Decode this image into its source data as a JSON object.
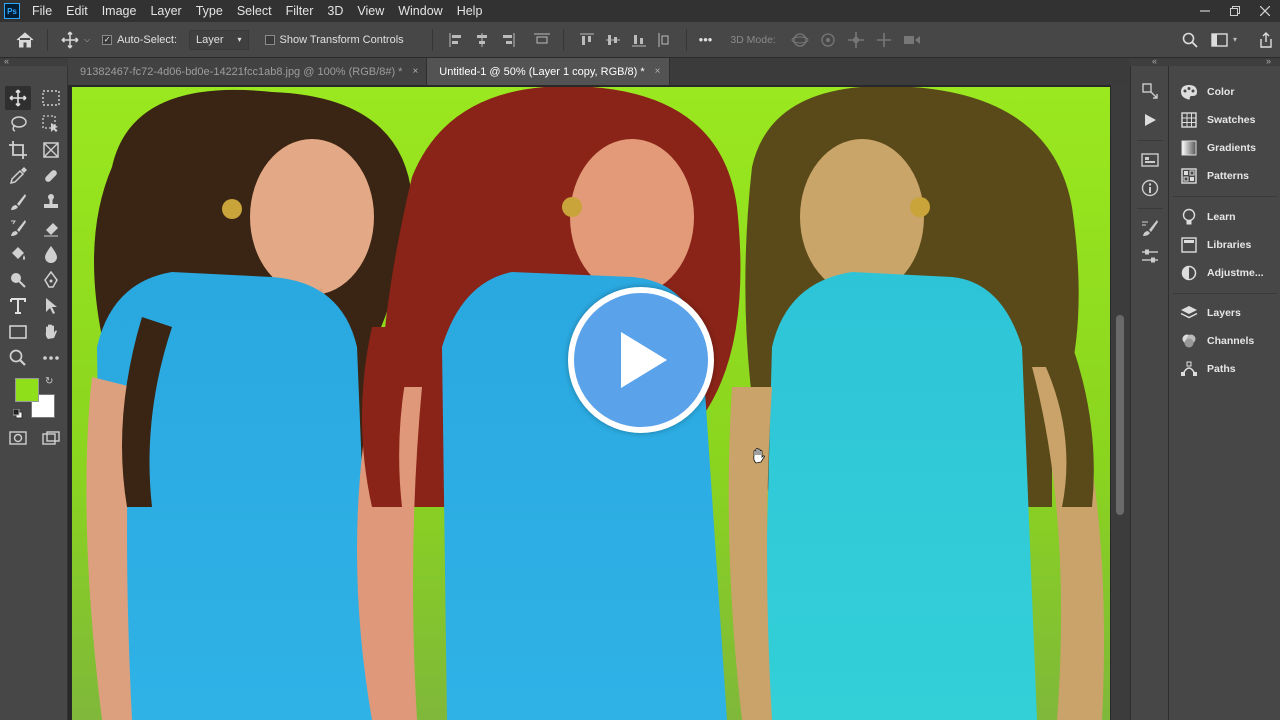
{
  "app": {
    "logo_text": "Ps"
  },
  "menu": [
    "File",
    "Edit",
    "Image",
    "Layer",
    "Type",
    "Select",
    "Filter",
    "3D",
    "View",
    "Window",
    "Help"
  ],
  "options": {
    "auto_select_label": "Auto-Select:",
    "auto_select_checked": true,
    "target_value": "Layer",
    "show_transform_label": "Show Transform Controls",
    "show_transform_checked": false,
    "mode_3d_label": "3D Mode:",
    "more_label": "•••"
  },
  "tabs": [
    {
      "label": "91382467-fc72-4d06-bd0e-14221fcc1ab8.jpg @ 100% (RGB/8#) *",
      "active": false
    },
    {
      "label": "Untitled-1 @ 50% (Layer 1 copy, RGB/8) *",
      "active": true
    }
  ],
  "tab_close_glyph": "×",
  "colors": {
    "foreground": "#8fe01a",
    "background": "#ffffff",
    "canvas_bg": "#9ae81f",
    "play_button": "#5aa2ea"
  },
  "right_panels": {
    "group1": [
      "Color",
      "Swatches",
      "Gradients",
      "Patterns"
    ],
    "group2": [
      "Learn",
      "Libraries",
      "Adjustme..."
    ],
    "group3": [
      "Layers",
      "Channels",
      "Paths"
    ]
  },
  "tools": [
    "move-tool",
    "artboard-tool",
    "lasso-tool",
    "object-selection-tool",
    "crop-tool",
    "frame-tool",
    "eyedropper-tool",
    "healing-brush-tool",
    "brush-tool",
    "clone-stamp-tool",
    "history-brush-tool",
    "eraser-tool",
    "paint-bucket-tool",
    "blur-tool",
    "dodge-tool",
    "pen-tool",
    "type-tool",
    "path-selection-tool",
    "rectangle-tool",
    "hand-tool",
    "zoom-tool",
    "more-tools"
  ]
}
